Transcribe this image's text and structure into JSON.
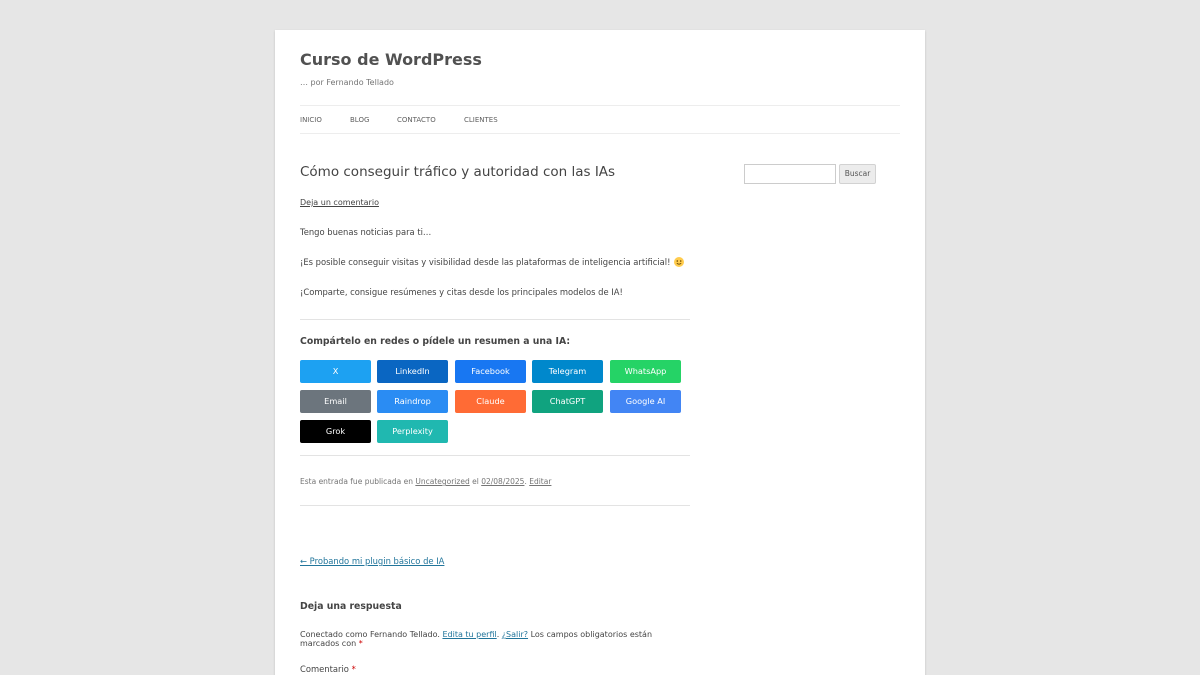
{
  "site": {
    "title": "Curso de WordPress",
    "description": "… por Fernando Tellado"
  },
  "nav": {
    "items": [
      {
        "label": "INICIO"
      },
      {
        "label": "BLOG"
      },
      {
        "label": "CONTACTO"
      },
      {
        "label": "CLIENTES"
      }
    ]
  },
  "post": {
    "title": "Cómo conseguir tráfico y autoridad con las IAs",
    "comment_link": "Deja un comentario",
    "paragraphs": [
      "Tengo buenas noticias para ti…",
      "¡Es posible conseguir visitas y visibilidad desde las plataformas de inteligencia artificial!",
      "¡Comparte, consigue resúmenes y citas desde los principales modelos de IA!"
    ],
    "emoji_icon": "smiley-icon"
  },
  "share": {
    "heading": "Compártelo en redes o pídele un resumen a una IA:",
    "buttons": [
      {
        "label": "X",
        "color": "#1da1f2"
      },
      {
        "label": "LinkedIn",
        "color": "#0a66c2"
      },
      {
        "label": "Facebook",
        "color": "#1877f2"
      },
      {
        "label": "Telegram",
        "color": "#0088cc"
      },
      {
        "label": "WhatsApp",
        "color": "#25d366"
      },
      {
        "label": "Email",
        "color": "#6c757d"
      },
      {
        "label": "Raindrop",
        "color": "#2a8cf3"
      },
      {
        "label": "Claude",
        "color": "#ff6b35"
      },
      {
        "label": "ChatGPT",
        "color": "#10a37f"
      },
      {
        "label": "Google AI",
        "color": "#4285f4"
      },
      {
        "label": "Grok",
        "color": "#000000"
      },
      {
        "label": "Perplexity",
        "color": "#20b8b0"
      }
    ]
  },
  "meta": {
    "prefix": "Esta entrada fue publicada en",
    "category": "Uncategorized",
    "mid": "el",
    "date": "02/08/2025",
    "edit": "Editar"
  },
  "prev_post": "← Probando mi plugin básico de IA",
  "reply": {
    "title": "Deja una respuesta",
    "logged_prefix": "Conectado como Fernando Tellado.",
    "edit_profile": "Edita tu perfil",
    "logout": "¿Salir?",
    "required_note": "Los campos obligatorios están marcados con",
    "asterisk": "*",
    "comment_label": "Comentario"
  },
  "search": {
    "placeholder": "",
    "button": "Buscar"
  }
}
